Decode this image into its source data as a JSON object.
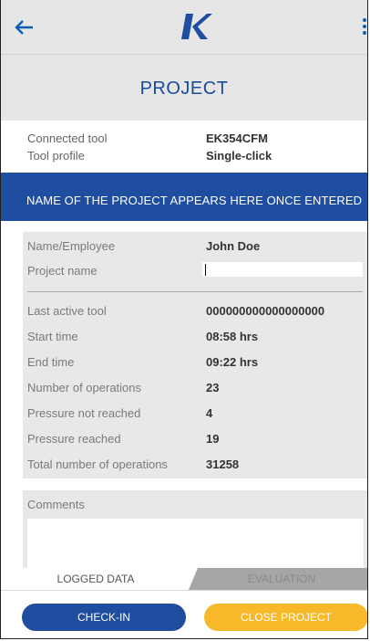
{
  "header": {
    "back_icon": "arrow-left-icon",
    "logo": "K",
    "menu_icon": "kebab-menu-icon",
    "accent_color": "#1a4aa0"
  },
  "page": {
    "title": "PROJECT"
  },
  "tool": {
    "connected_label": "Connected tool",
    "connected_value": "EK354CFM",
    "profile_label": "Tool profile",
    "profile_value": "Single-click"
  },
  "banner": {
    "text": "NAME OF THE PROJECT APPEARS HERE ONCE ENTERED",
    "color": "#1f4da0"
  },
  "details": {
    "employee_label": "Name/Employee",
    "employee_value": "John Doe",
    "project_label": "Project name",
    "project_value": "",
    "stats": [
      {
        "label": "Last active tool",
        "value": "000000000000000000"
      },
      {
        "label": "Start time",
        "value": "08:58 hrs"
      },
      {
        "label": "End time",
        "value": "09:22 hrs"
      },
      {
        "label": "Number of operations",
        "value": "23"
      },
      {
        "label": "Pressure not reached",
        "value": "4"
      },
      {
        "label": "Pressure reached",
        "value": "19"
      },
      {
        "label": "Total number of operations",
        "value": "31258"
      }
    ]
  },
  "comments": {
    "label": "Comments",
    "value": ""
  },
  "tabs": {
    "logged": "LOGGED DATA",
    "evaluation": "EVALUATION"
  },
  "actions": {
    "checkin": "CHECK-IN",
    "close": "CLOSE PROJECT",
    "checkin_color": "#1f4da0",
    "close_color": "#f7b92a"
  }
}
